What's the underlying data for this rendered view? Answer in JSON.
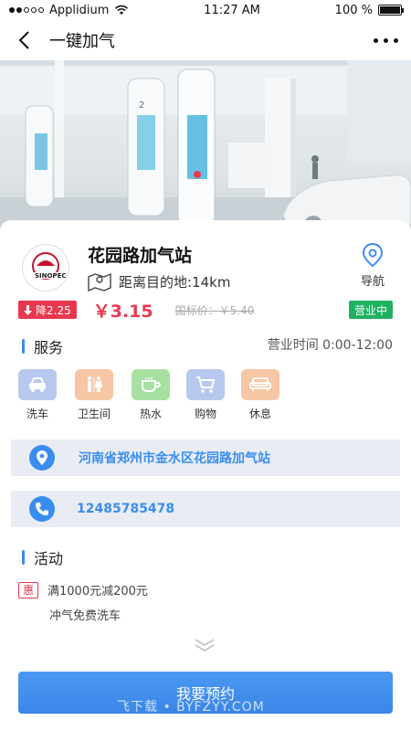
{
  "status_bar": {
    "carrier": "Applidium",
    "time": "11:27 AM",
    "battery": "100 %",
    "battery_level": 1.0
  },
  "nav": {
    "title": "一键加气"
  },
  "station": {
    "name": "花园路加气站",
    "distance": "距离目的地:14km",
    "nav_label": "导航"
  },
  "price": {
    "drop": "降2.25",
    "current": "￥3.15",
    "standard": "国标价：￥5.40",
    "status": "营业中"
  },
  "services": {
    "heading": "服务",
    "hours": "营业时间 0:00-12:00",
    "items": [
      {
        "label": "洗车",
        "icon": "car-icon",
        "color": "#b7c9ef"
      },
      {
        "label": "卫生间",
        "icon": "restroom-icon",
        "color": "#f7c6a4"
      },
      {
        "label": "热水",
        "icon": "cup-icon",
        "color": "#a8e0a2"
      },
      {
        "label": "购物",
        "icon": "cart-icon",
        "color": "#b7c9ef"
      },
      {
        "label": "休息",
        "icon": "sofa-icon",
        "color": "#f7c6a4"
      }
    ]
  },
  "address": "河南省郑州市金水区花园路加气站",
  "phone": "12485785478",
  "activity": {
    "heading": "活动",
    "badge": "惠",
    "line1": "满1000元减200元",
    "line2": "冲气免费洗车"
  },
  "book_button": "我要预约",
  "watermark": "飞下载 • BYFZYY.COM",
  "colors": {
    "accent": "#3a8df0",
    "price_red": "#e8384f",
    "open_green": "#1fb160"
  }
}
